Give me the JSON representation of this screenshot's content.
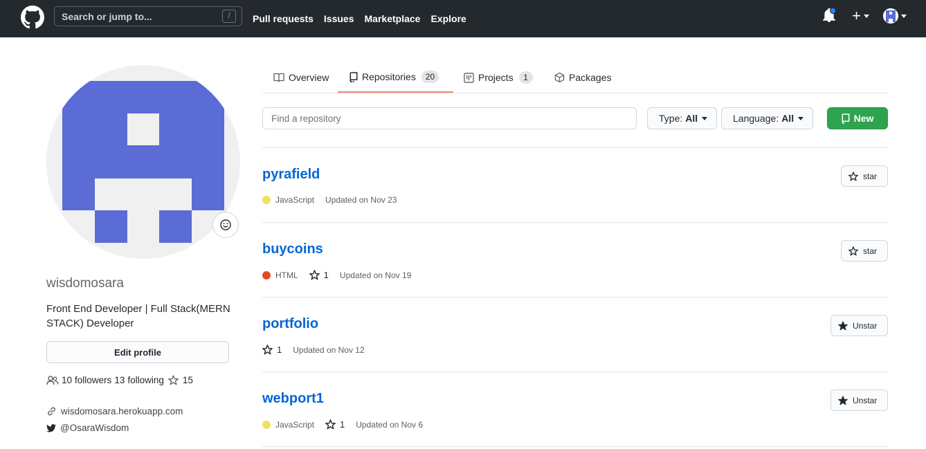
{
  "header": {
    "search_placeholder": "Search or jump to...",
    "search_hint": "/",
    "nav": [
      "Pull requests",
      "Issues",
      "Marketplace",
      "Explore"
    ],
    "plus_label": "+"
  },
  "profile": {
    "username": "wisdomosara",
    "bio": "Front End Developer | Full Stack(MERN STACK) Developer",
    "edit_label": "Edit profile",
    "followers_count": "10",
    "followers_label": "followers",
    "following_count": "13",
    "following_label": "following",
    "stars_count": "15",
    "website": "wisdomosara.herokuapp.com",
    "twitter": "@OsaraWisdom",
    "avatar_color": "#5b6cd6"
  },
  "tabs": [
    {
      "label": "Overview",
      "count": null
    },
    {
      "label": "Repositories",
      "count": "20"
    },
    {
      "label": "Projects",
      "count": "1"
    },
    {
      "label": "Packages",
      "count": null
    }
  ],
  "filters": {
    "find_placeholder": "Find a repository",
    "type_label": "Type:",
    "type_value": "All",
    "language_label": "Language:",
    "language_value": "All",
    "new_label": "New"
  },
  "repos": [
    {
      "name": "pyrafield",
      "language": "JavaScript",
      "lang_color": "#f1e05a",
      "stars": "",
      "updated": "Updated on Nov 23",
      "star_label": "star"
    },
    {
      "name": "buycoins",
      "language": "HTML",
      "lang_color": "#e34c26",
      "stars": "1",
      "updated": "Updated on Nov 19",
      "star_label": "star"
    },
    {
      "name": "portfolio",
      "language": "",
      "lang_color": "",
      "stars": "1",
      "updated": "Updated on Nov 12",
      "star_label": "Unstar"
    },
    {
      "name": "webport1",
      "language": "JavaScript",
      "lang_color": "#f1e05a",
      "stars": "1",
      "updated": "Updated on Nov 6",
      "star_label": "Unstar"
    }
  ],
  "colors": {
    "header_bg": "#24292e",
    "link": "#0366d6",
    "new_button": "#2ea44f",
    "tab_underline": "#f9826c"
  }
}
